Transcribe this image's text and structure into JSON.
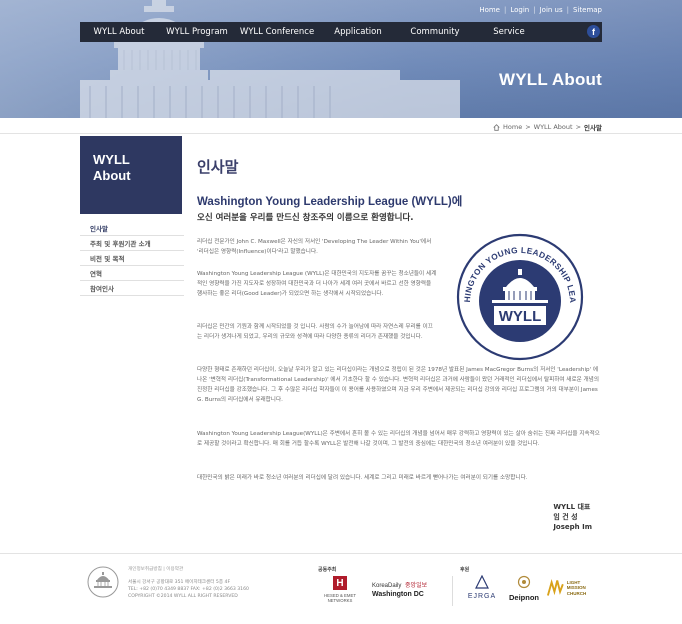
{
  "header": {
    "util_links": [
      "Home",
      "Login",
      "Join us",
      "Sitemap"
    ],
    "nav": [
      "WYLL About",
      "WYLL Program",
      "WYLL Conference",
      "Application",
      "Community",
      "Service"
    ],
    "facebook_icon": "f",
    "page_title": "WYLL About"
  },
  "breadcrumb": {
    "home": "Home",
    "sep": ">",
    "section": "WYLL About",
    "current": "인사말"
  },
  "lnb": {
    "title_line1": "WYLL",
    "title_line2": "About",
    "items": [
      "인사말",
      "주최 및 후원기관 소개",
      "비전 및 목적",
      "연혁",
      "참여인사"
    ]
  },
  "content": {
    "heading": "인사말",
    "title": "Washington Young Leadership League (WYLL)에",
    "subtitle": "오신 여러분을 우리를 만드신 창조주의 이름으로 환영합니다.",
    "p1": "리더십 전문가인 John C. Maxwell은 자신의 저서인 'Developing The Leader Within You'에서 '리더십은 영향력(Influence)이다'라고 말했습니다.",
    "p2": "Washington Young Leadership League (WYLL)은 대한민국의 지도자를 꿈꾸는 청소년들이 세계적인 영향력을 가진 지도자로 성장하여 대한민국과 더 나아가 세계 여러 곳에서 바르고 선한 영향력을 행사하는 좋은 리더(Good Leader)가 되었으면 하는 생각에서 시작되었습니다.",
    "p3": "리더십은 민간의 기원과 함께 시작되었을 것 입니다. 사람의 수가 늘어남에 따라 자연스레 무리를 이끄는 리더가 생겨나게 되었고, 우리의 규모와 성격에 따라 다양한 종류의 리더가 존재했을 것입니다.",
    "p4": "다양한 형태로 존재하던 리더십이, 오늘날 우리가 알고 있는 리더십이라는 개념으로 정립이 된 것은 1978년 발표된 James MacGregor Burns의 저서인 'Leadership' 에 나온 '변혁적 리더십(Transformational Leadership)' 에서 기초한다 할 수 있습니다. 변혁적 리더십은 과거에 사람들이 왔던 거래적인 리더십에서 탈피하여 새로운 개념의 진정한 리더십을 강조했습니다. 그 후 수많은 리더십 학자들이 이 용어를 사용하였으며 지금 우리 주변에서 제공되는 리더십 강의와 리더십 프로그램의 거의 대부분이 James G. Burns의 리더십에서 유래합니다.",
    "p5": "Washington Young Leadership League(WYLL)은 주변에서 흔히 볼 수 있는 리더십의 개념을 넘어서 매우 강력하고 영향력이 있는 살아 숨쉬는 진짜 리더십을 지속적으로 제공할 것이라고 확신합니다. 매 회를 거듭 할수록 WYLL은 발전해 나갈 것이며, 그 발전의 중심에는 대한민국의 청소년 여러분이 있을 것입니다.",
    "p6": "대한민국의 밝은 미래가 바로 청소년 여러분의 리더십에 달려 있습니다. 세계로 그리고 미래로 바르게 뻗어나가는 여러분이 되기를 소망합니다.",
    "sign_role": "WYLL 대표",
    "sign_name_ko": "임 건 성",
    "sign_name_en": "Joseph Im"
  },
  "seal": {
    "ring_text": "WASHINGTON YOUNG LEADERSHIP LEAGUE",
    "center": "WYLL"
  },
  "footer": {
    "links": "개인정보취급방침  |  이용약관",
    "address": "서울시 강서구 공항대로 351 에이치테크센터 5층 4F",
    "phone": "TEL: +82 (0)70 4349 8837  FAX: +82 (0)2 3663 3160",
    "copyright": "COPYRIGHT ©2014 WYLL ALL RIGHT RESERVED",
    "host_label": "공동주최",
    "support_label": "후원",
    "host1": "HESED & EMET NETWORKS",
    "host2a": "KoreaDaily",
    "host2b": "중앙일보",
    "host2c": "Washington DC",
    "support1": "EJRGA",
    "support2": "Deipnon",
    "support3a": "LIGHT",
    "support3b": "MISSION CHURCH",
    "hesed_letter": "H"
  },
  "colors": {
    "nav_bg": "#242a38",
    "lnb_bg": "#2e3861",
    "accent": "#2e3a6e",
    "seal": "#2c3b73"
  }
}
